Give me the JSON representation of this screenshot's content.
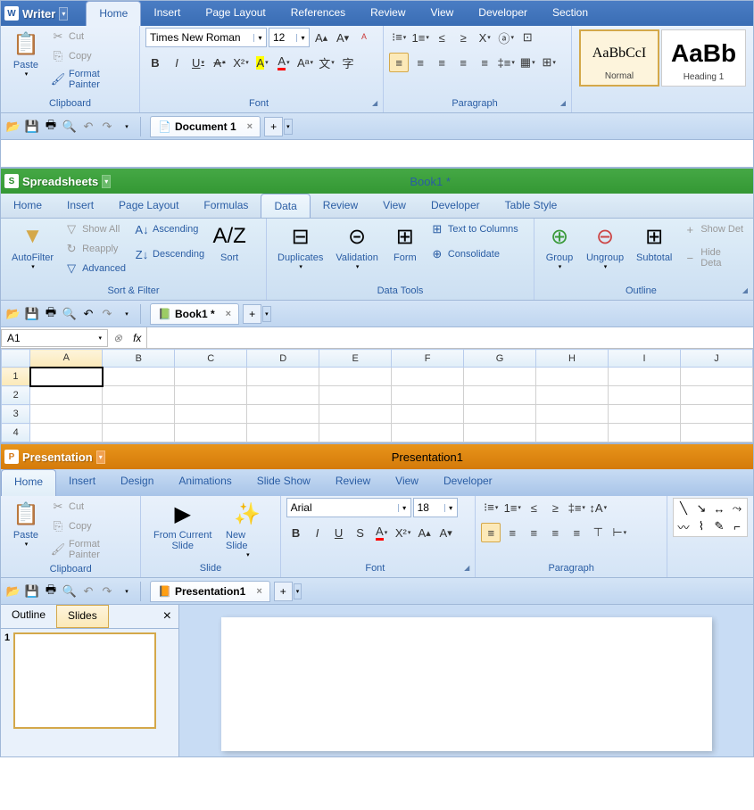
{
  "writer": {
    "title": "Writer",
    "tabs": [
      "Home",
      "Insert",
      "Page Layout",
      "References",
      "Review",
      "View",
      "Developer",
      "Section"
    ],
    "activeTab": "Home",
    "clipboard": {
      "paste": "Paste",
      "cut": "Cut",
      "copy": "Copy",
      "formatPainter": "Format Painter",
      "groupLabel": "Clipboard"
    },
    "font": {
      "family": "Times New Roman",
      "size": "12",
      "groupLabel": "Font"
    },
    "paragraph": {
      "groupLabel": "Paragraph"
    },
    "styles": {
      "normal": {
        "preview": "AaBbCcI",
        "name": "Normal"
      },
      "heading1": {
        "preview": "AaBb",
        "name": "Heading 1"
      }
    },
    "docTab": "Document 1"
  },
  "spreadsheet": {
    "title": "Spreadsheets",
    "docTitle": "Book1 *",
    "tabs": [
      "Home",
      "Insert",
      "Page Layout",
      "Formulas",
      "Data",
      "Review",
      "View",
      "Developer",
      "Table Style"
    ],
    "activeTab": "Data",
    "autofilter": "AutoFilter",
    "showAll": "Show All",
    "reapply": "Reapply",
    "advanced": "Advanced",
    "ascending": "Ascending",
    "descending": "Descending",
    "sort": "Sort",
    "sortFilterLabel": "Sort & Filter",
    "duplicates": "Duplicates",
    "validation": "Validation",
    "form": "Form",
    "textToColumns": "Text to Columns",
    "consolidate": "Consolidate",
    "dataToolsLabel": "Data Tools",
    "group": "Group",
    "ungroup": "Ungroup",
    "subtotal": "Subtotal",
    "showDetail": "Show Det",
    "hideDetail": "Hide Deta",
    "outlineLabel": "Outline",
    "docTab": "Book1 *",
    "activeCell": "A1",
    "columns": [
      "A",
      "B",
      "C",
      "D",
      "E",
      "F",
      "G",
      "H",
      "I",
      "J"
    ],
    "rows": [
      "1",
      "2",
      "3",
      "4"
    ]
  },
  "presentation": {
    "title": "Presentation",
    "docTitle": "Presentation1",
    "tabs": [
      "Home",
      "Insert",
      "Design",
      "Animations",
      "Slide Show",
      "Review",
      "View",
      "Developer"
    ],
    "activeTab": "Home",
    "clipboard": {
      "paste": "Paste",
      "cut": "Cut",
      "copy": "Copy",
      "formatPainter": "Format Painter",
      "groupLabel": "Clipboard"
    },
    "fromCurrent": "From Current Slide",
    "newSlide": "New Slide",
    "slideLabel": "Slide",
    "font": {
      "family": "Arial",
      "size": "18",
      "groupLabel": "Font"
    },
    "paragraph": {
      "groupLabel": "Paragraph"
    },
    "docTab": "Presentation1",
    "outlineTab": "Outline",
    "slidesTab": "Slides",
    "slideNum": "1"
  }
}
